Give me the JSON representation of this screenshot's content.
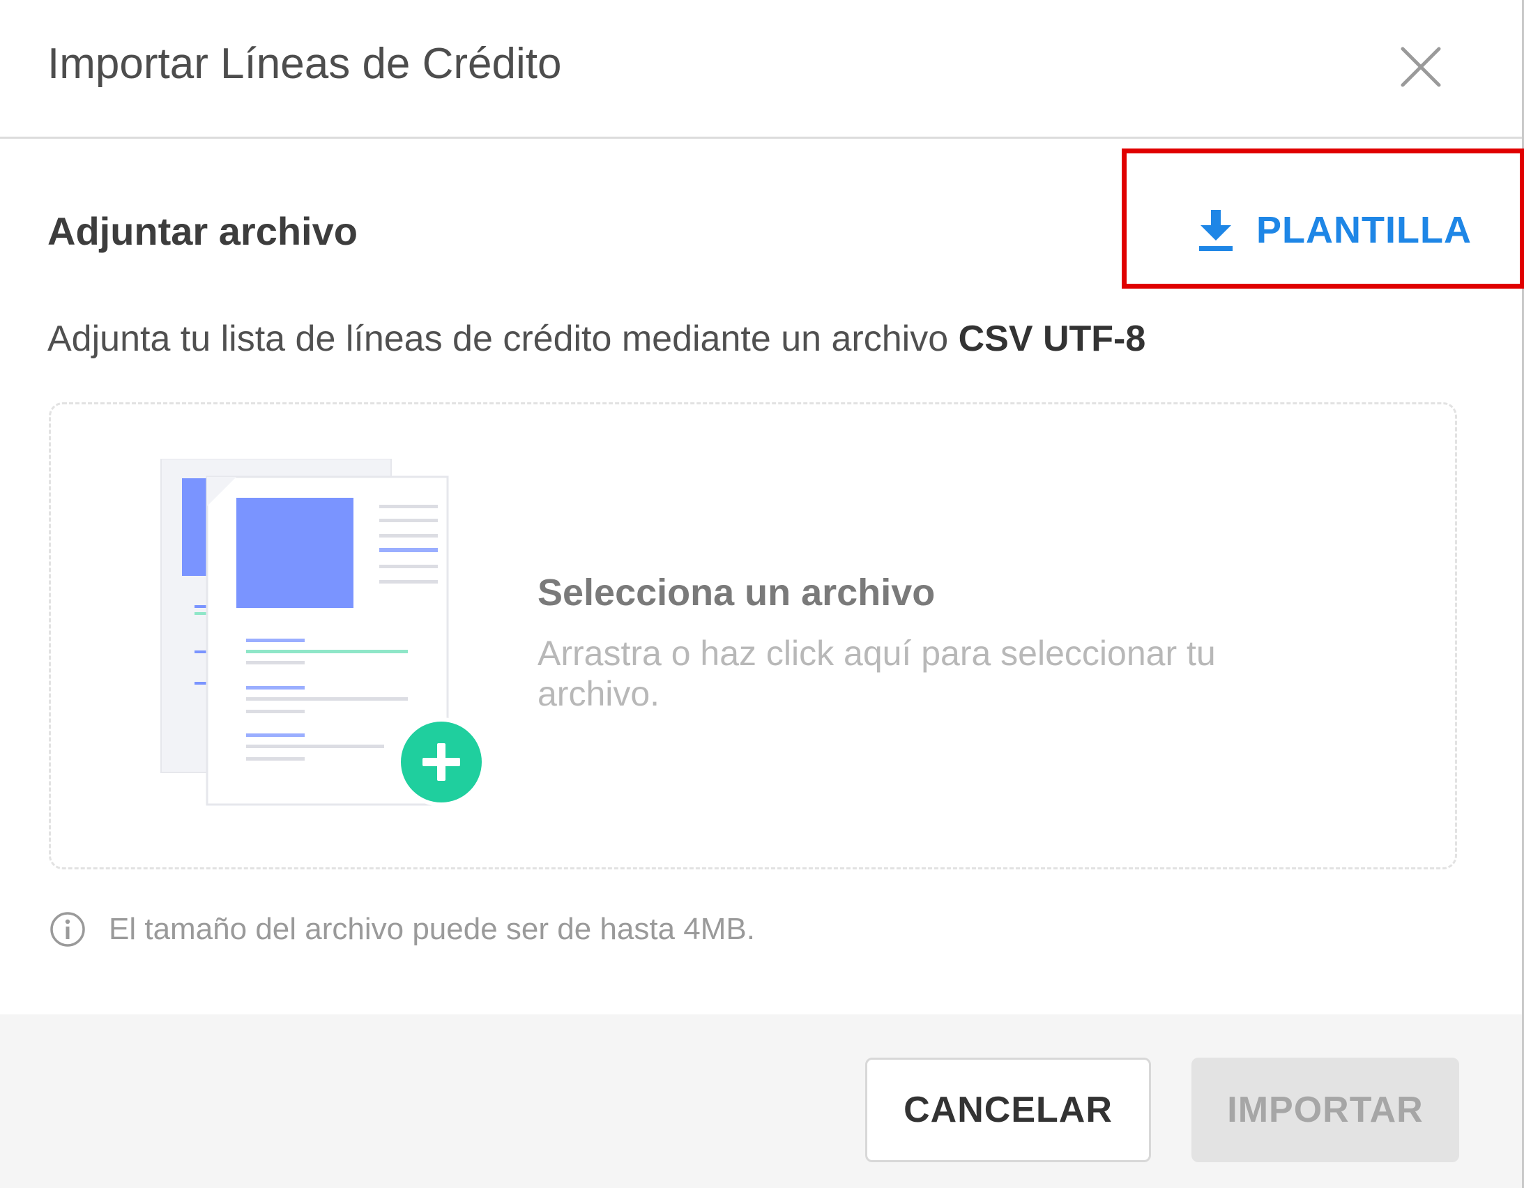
{
  "dialog": {
    "title": "Importar Líneas de Crédito",
    "close_icon": "close-icon"
  },
  "section": {
    "title": "Adjuntar archivo",
    "template_button": {
      "label": "PLANTILLA",
      "icon": "download-icon",
      "color": "#1e86e6"
    },
    "highlight_color": "#e00000"
  },
  "description": {
    "text": "Adjunta tu lista de líneas de crédito mediante un archivo ",
    "format": "CSV UTF-8"
  },
  "dropzone": {
    "title": "Selecciona un archivo",
    "subtitle": "Arrastra o haz click aquí para seleccionar tu archivo.",
    "illustration_icon": "documents-add-icon",
    "add_icon_color": "#1fcf9e",
    "doc_accent_color": "#7a94ff"
  },
  "info": {
    "icon": "info-icon",
    "text": "El tamaño del archivo puede ser de hasta 4MB."
  },
  "footer": {
    "cancel_label": "CANCELAR",
    "import_label": "IMPORTAR",
    "import_disabled": true
  }
}
